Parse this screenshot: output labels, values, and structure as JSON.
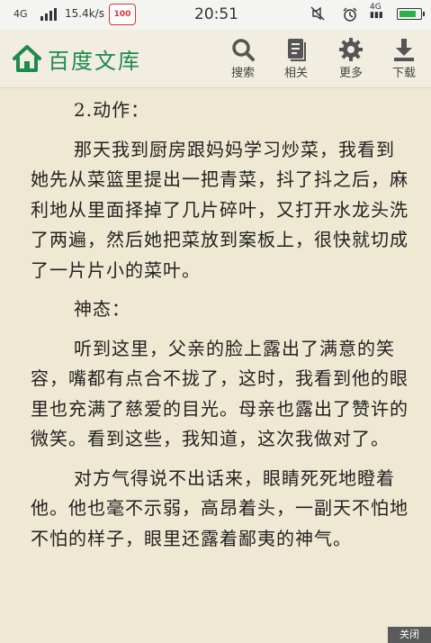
{
  "status_bar": {
    "network": "4G",
    "speed": "15.4k/s",
    "app_badge": "100",
    "time": "20:51",
    "network_right": "4G",
    "battery_level": 0.85,
    "battery_color": "#2db24a"
  },
  "header": {
    "brand": "百度文库",
    "brand_color": "#1e8a4d",
    "toolbar": {
      "search_label": "搜索",
      "related_label": "相关",
      "more_label": "更多",
      "download_label": "下载"
    }
  },
  "content": {
    "heading_action": "2.动作：",
    "para_action": "那天我到厨房跟妈妈学习炒菜，我看到她先从菜篮里提出一把青菜，抖了抖之后，麻利地从里面择掉了几片碎叶，又打开水龙头洗了两遍，然后她把菜放到案板上，很快就切成了一片片小的菜叶。",
    "heading_expression": "神态：",
    "para_expression_1": "听到这里，父亲的脸上露出了满意的笑容，嘴都有点合不拢了，这时，我看到他的眼里也充满了慈爱的目光。母亲也露出了赞许的微笑。看到这些，我知道，这次我做对了。",
    "para_expression_2": "对方气得说不出话来，眼睛死死地瞪着他。他也毫不示弱，高昂着头，一副天不怕地不怕的样子，眼里还露着鄙夷的神气。"
  },
  "close_label": "关闭"
}
